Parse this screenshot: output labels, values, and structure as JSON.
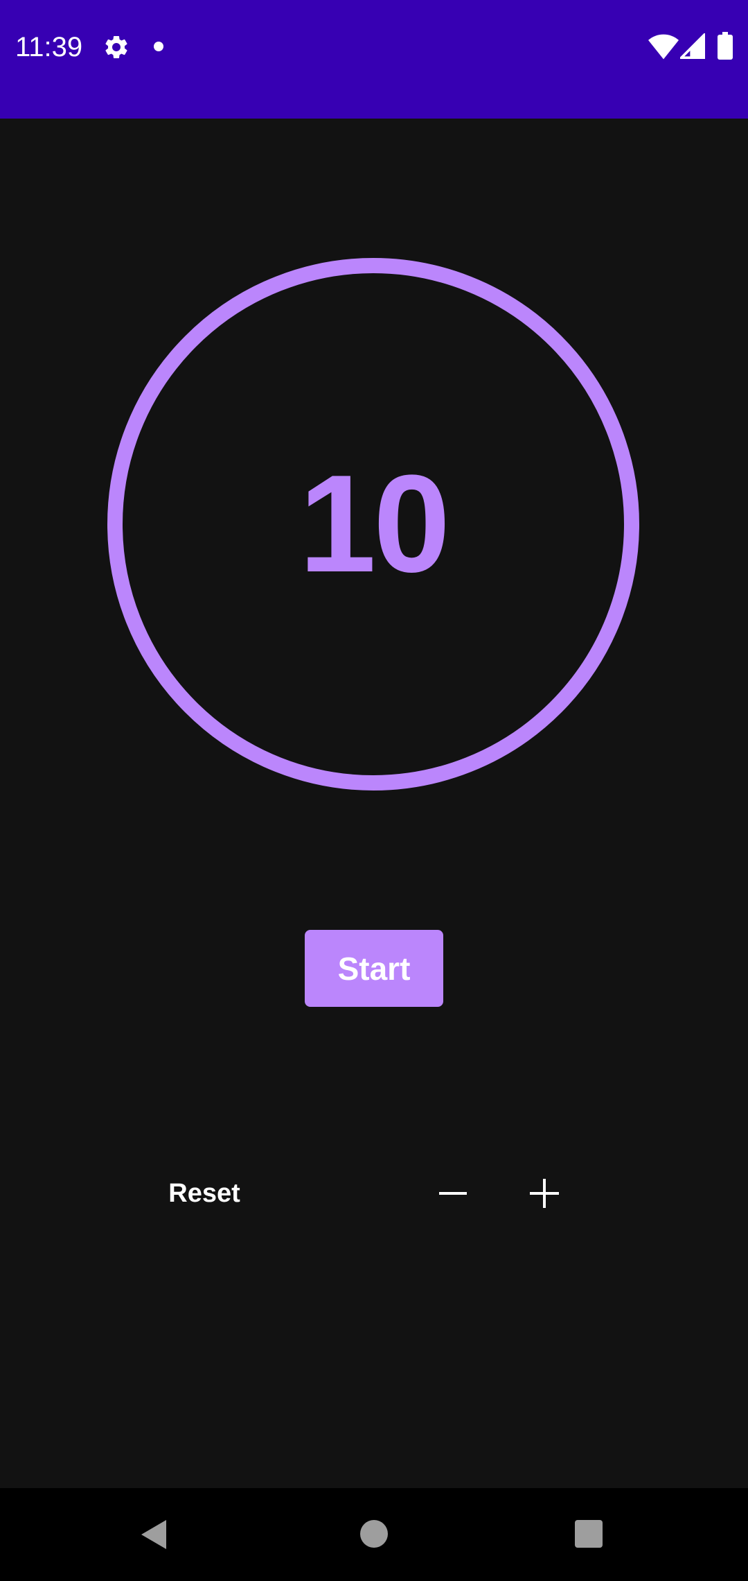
{
  "status_bar": {
    "time": "11:39",
    "background_color": "#3700B3",
    "icons": [
      "gear-icon",
      "notification-dot-icon",
      "wifi-icon",
      "cell-signal-icon",
      "battery-icon"
    ]
  },
  "timer": {
    "value": "10",
    "accent_color": "#BB86FC"
  },
  "controls": {
    "start_label": "Start",
    "reset_label": "Reset",
    "decrement_icon": "minus-icon",
    "increment_icon": "plus-icon"
  },
  "nav_bar": {
    "icons": [
      "back-icon",
      "home-icon",
      "recents-icon"
    ]
  },
  "theme": {
    "background": "#121212",
    "text": "#FFFFFF"
  }
}
